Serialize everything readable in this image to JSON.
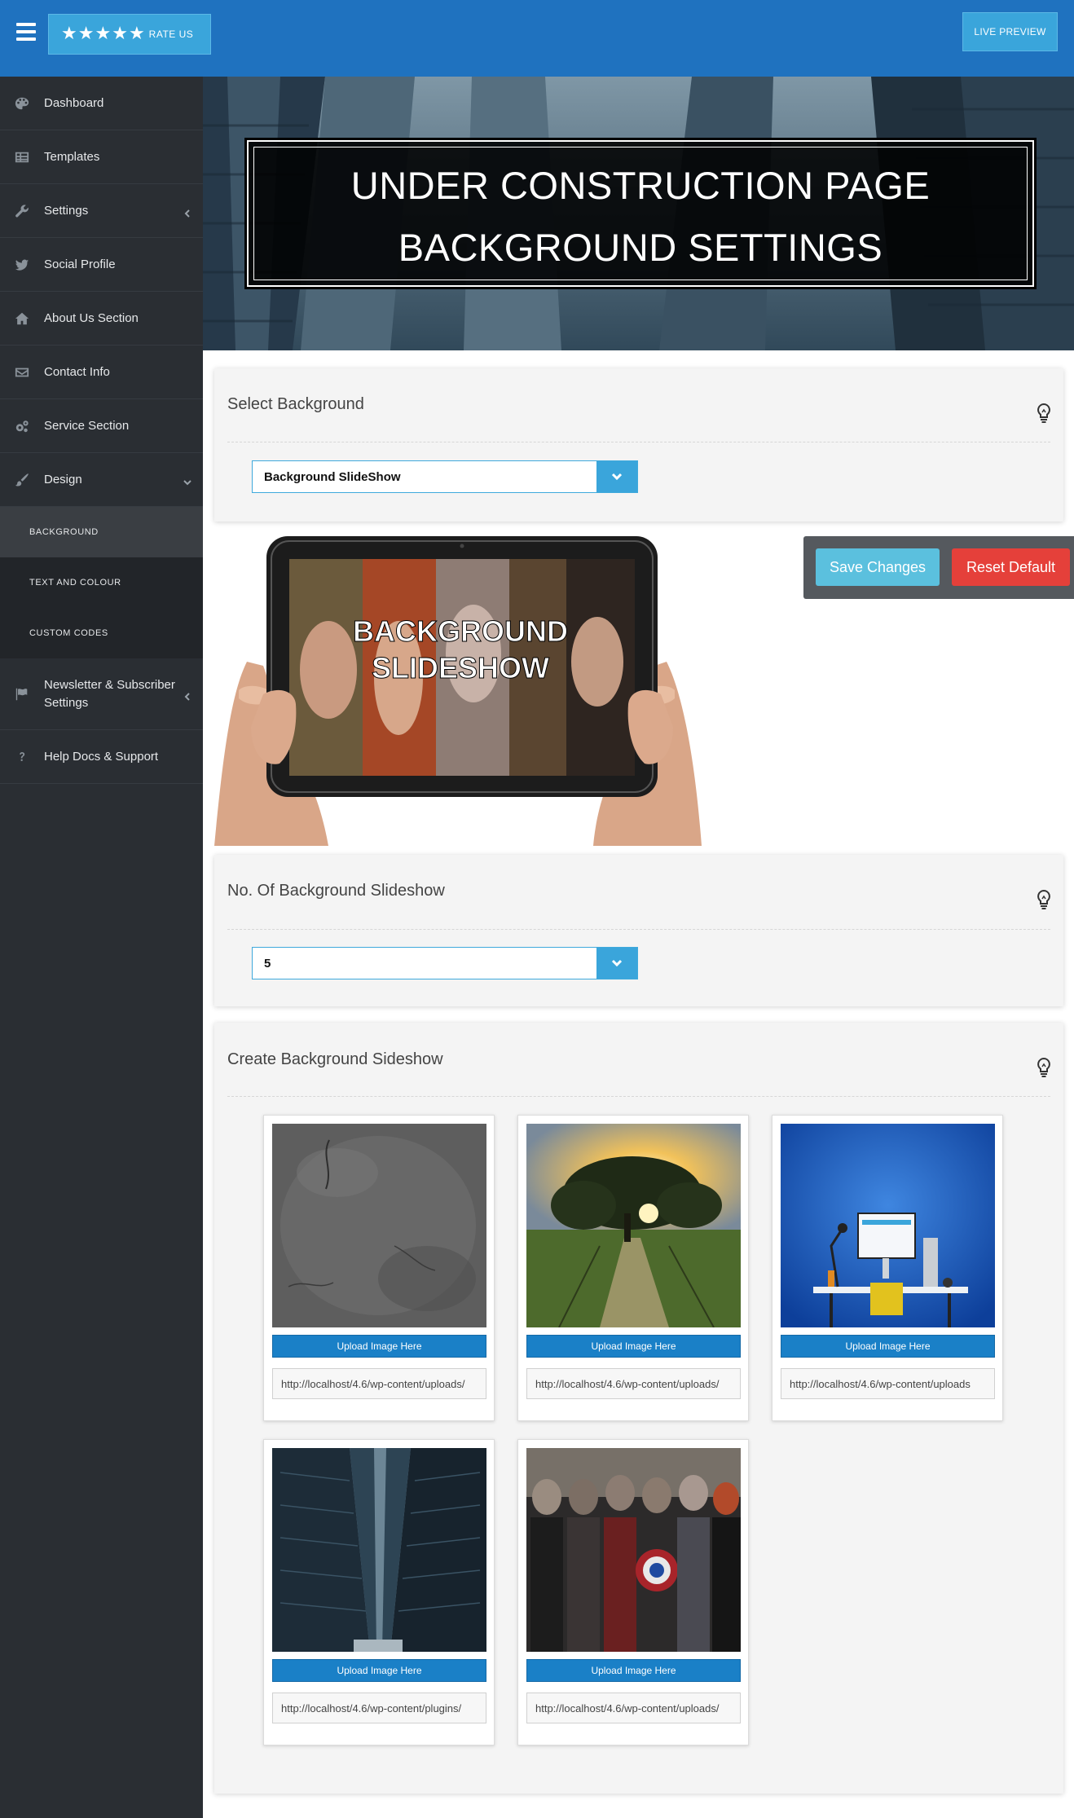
{
  "topbar": {
    "rate_label": "RATE US",
    "stars": 5,
    "live_preview_label": "LIVE PREVIEW",
    "bg_color": "#1f72bf"
  },
  "sidebar": {
    "items": [
      {
        "label": "Dashboard",
        "icon": "palette-icon"
      },
      {
        "label": "Templates",
        "icon": "grid-table-icon"
      },
      {
        "label": "Settings",
        "icon": "wrench-icon"
      },
      {
        "label": "Social Profile",
        "icon": "twitter-bird-icon"
      },
      {
        "label": "About Us Section",
        "icon": "home-icon"
      },
      {
        "label": "Contact Info",
        "icon": "envelope-icon"
      },
      {
        "label": "Service Section",
        "icon": "gears-icon"
      },
      {
        "label": "Design",
        "icon": "brush-icon"
      }
    ],
    "design_sub": [
      "BACKGROUND",
      "TEXT AND COLOUR",
      "CUSTOM CODES"
    ],
    "items_after": [
      {
        "label": "Newsletter & Subscriber Settings",
        "icon": "flag-icon"
      },
      {
        "label": "Help Docs & Support",
        "icon": "question-icon"
      }
    ]
  },
  "hero": {
    "line1": "UNDER CONSTRUCTION PAGE",
    "line2": "BACKGROUND SETTINGS"
  },
  "select_background": {
    "title": "Select Background",
    "value": "Background SlideShow"
  },
  "tablet": {
    "line1": "BACKGROUND",
    "line2": "SLIDESHOW"
  },
  "actions": {
    "save": "Save Changes",
    "reset": "Reset Default"
  },
  "slideshow_count": {
    "title": "No. Of Background Slideshow",
    "value": "5"
  },
  "create_slideshow": {
    "title": "Create Background Sideshow",
    "cards": [
      {
        "upload_label": "Upload Image Here",
        "url": "http://localhost/4.6/wp-content/uploads/",
        "image": "stone-texture"
      },
      {
        "upload_label": "Upload Image Here",
        "url": "http://localhost/4.6/wp-content/uploads/",
        "image": "sunset-tree-field"
      },
      {
        "upload_label": "Upload Image Here",
        "url": "http://localhost/4.6/wp-content/uploads",
        "image": "desk-computer-blue"
      },
      {
        "upload_label": "Upload Image Here",
        "url": "http://localhost/4.6/wp-content/plugins/",
        "image": "city-skyscrapers"
      },
      {
        "upload_label": "Upload Image Here",
        "url": "http://localhost/4.6/wp-content/uploads/",
        "image": "superhero-group"
      }
    ]
  },
  "colors": {
    "accent": "#3aa5db",
    "sidebar_bg": "#2a2e33",
    "save_btn": "#5bc0de",
    "reset_btn": "#e5403a",
    "upload_btn": "#1a80c7"
  }
}
